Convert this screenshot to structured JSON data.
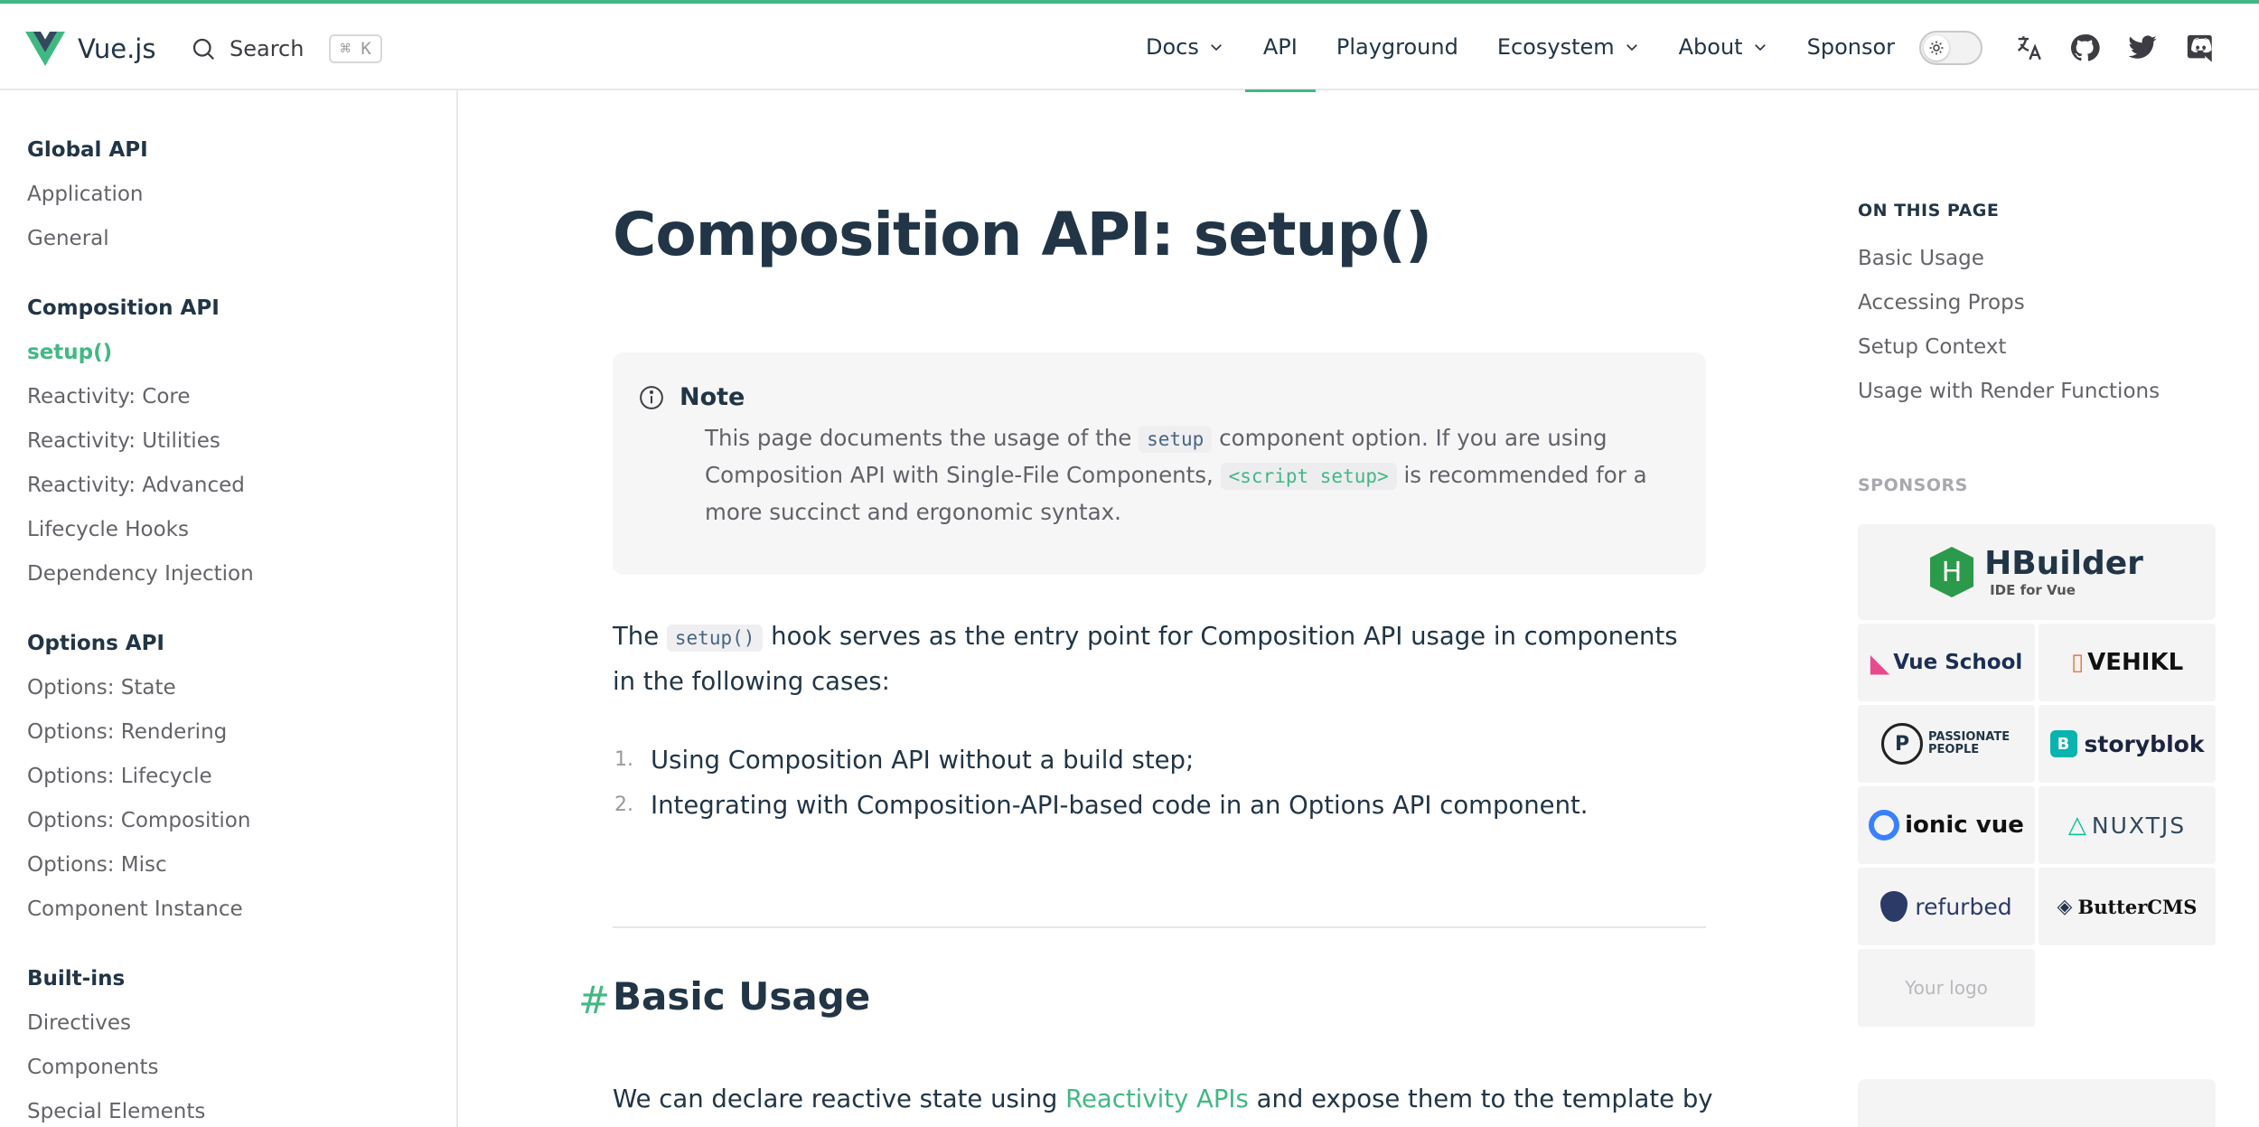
{
  "brand": {
    "name": "Vue.js",
    "accent": "#42b883"
  },
  "search": {
    "label": "Search",
    "shortcut": "⌘ K"
  },
  "nav": {
    "items": [
      {
        "label": "Docs",
        "has_dropdown": true,
        "active": false
      },
      {
        "label": "API",
        "has_dropdown": false,
        "active": true
      },
      {
        "label": "Playground",
        "has_dropdown": false,
        "active": false
      },
      {
        "label": "Ecosystem",
        "has_dropdown": true,
        "active": false
      },
      {
        "label": "About",
        "has_dropdown": true,
        "active": false
      },
      {
        "label": "Sponsor",
        "has_dropdown": false,
        "active": false
      }
    ],
    "icons": [
      "appearance-toggle",
      "translate-icon",
      "github-icon",
      "twitter-icon",
      "discord-icon"
    ]
  },
  "sidebar": {
    "groups": [
      {
        "title": "Global API",
        "items": [
          "Application",
          "General"
        ]
      },
      {
        "title": "Composition API",
        "items": [
          "setup()",
          "Reactivity: Core",
          "Reactivity: Utilities",
          "Reactivity: Advanced",
          "Lifecycle Hooks",
          "Dependency Injection"
        ],
        "active": "setup()"
      },
      {
        "title": "Options API",
        "items": [
          "Options: State",
          "Options: Rendering",
          "Options: Lifecycle",
          "Options: Composition",
          "Options: Misc",
          "Component Instance"
        ]
      },
      {
        "title": "Built-ins",
        "items": [
          "Directives",
          "Components",
          "Special Elements"
        ]
      }
    ]
  },
  "main": {
    "title": "Composition API: setup()",
    "note": {
      "heading": "Note",
      "text_1": "This page documents the usage of the ",
      "code_1": "setup",
      "text_2": " component option. If you are using Composition API with Single-File Components, ",
      "code_2": "<script setup>",
      "text_3": " is recommended for a more succinct and ergonomic syntax."
    },
    "lead": {
      "text_1": "The ",
      "code": "setup()",
      "text_2": " hook serves as the entry point for Composition API usage in components in the following cases:"
    },
    "cases": [
      {
        "num": "1.",
        "text": "Using Composition API without a build step;"
      },
      {
        "num": "2.",
        "text": "Integrating with Composition-API-based code in an Options API component."
      }
    ],
    "section": {
      "anchor": "#",
      "title": "Basic Usage"
    },
    "para": {
      "text_1": "We can declare reactive state using ",
      "link": "Reactivity APIs",
      "text_2": " and expose them to the template by"
    }
  },
  "aside": {
    "toc_title": "ON THIS PAGE",
    "toc": [
      "Basic Usage",
      "Accessing Props",
      "Setup Context",
      "Usage with Render Functions"
    ],
    "sponsors_title": "SPONSORS",
    "sponsors_top": {
      "name": "HBuilder",
      "sub": "IDE for Vue"
    },
    "sponsors": [
      [
        "Vue School",
        "VEHIKL"
      ],
      [
        "PASSIONATE PEOPLE",
        "storyblok"
      ],
      [
        "ionic vue",
        "NUXTJS"
      ],
      [
        "refurbed",
        "ButterCMS"
      ]
    ],
    "your_logo": "Your logo"
  }
}
